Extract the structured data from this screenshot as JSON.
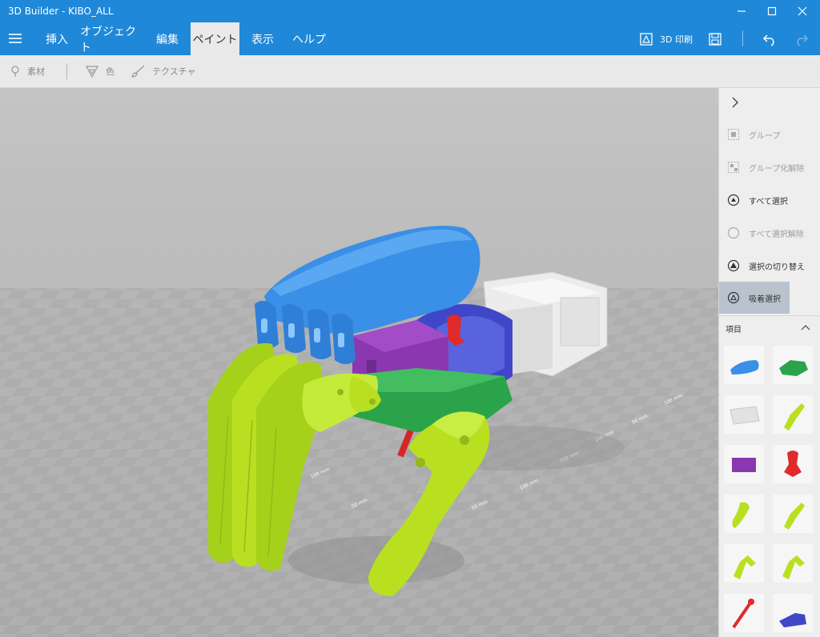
{
  "window": {
    "title": "3D Builder - KIBO_ALL"
  },
  "menu": {
    "tabs": [
      {
        "label": "挿入"
      },
      {
        "label": "オブジェクト"
      },
      {
        "label": "編集"
      },
      {
        "label": "ペイント"
      },
      {
        "label": "表示"
      },
      {
        "label": "ヘルプ"
      }
    ],
    "print_label": "3D 印刷"
  },
  "toolbar": {
    "material_label": "素材",
    "color_label": "色",
    "texture_label": "テクスチャ"
  },
  "side": {
    "commands": [
      {
        "label": "グループ"
      },
      {
        "label": "グループ化解除"
      },
      {
        "label": "すべて選択"
      },
      {
        "label": "すべて選択解除"
      },
      {
        "label": "選択の切り替え"
      },
      {
        "label": "吸着選択"
      }
    ],
    "items_label": "項目"
  },
  "ruler_labels": [
    "50 mm",
    "100 mm",
    "50 mm",
    "100 mm",
    "150 mm",
    "200 mm",
    "50 mm",
    "100 mm"
  ],
  "colors": {
    "accent": "#1f88d8",
    "blue_part": "#3a8fe6",
    "green_part": "#b8e021",
    "purple_part": "#8b38b0",
    "red_part": "#e12a2a",
    "dark_green_part": "#2ba34a"
  }
}
